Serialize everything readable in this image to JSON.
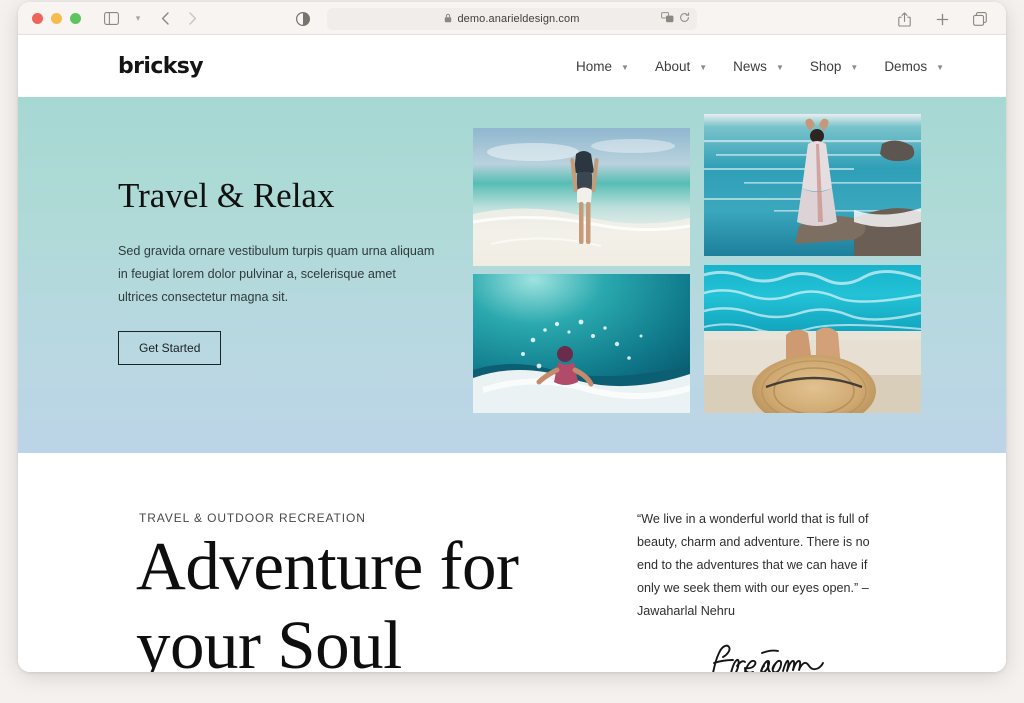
{
  "browser": {
    "url": "demo.anarieldesign.com",
    "lock_icon": "lock-icon",
    "reader_icon": "reader-appearance-icon",
    "sidebar_icon": "sidebar-toggle-icon",
    "back_icon": "back-arrow-icon",
    "forward_icon": "forward-arrow-icon",
    "extension_icon": "extension-icon",
    "reload_icon": "reload-icon",
    "share_icon": "share-icon",
    "newtab_icon": "plus-icon",
    "tabs_icon": "tab-overview-icon",
    "traffic_lights": [
      "close",
      "minimize",
      "maximize"
    ]
  },
  "site": {
    "logo": "bricksy",
    "nav": [
      {
        "label": "Home",
        "caret": "chevron-down-icon"
      },
      {
        "label": "About",
        "caret": "chevron-down-icon"
      },
      {
        "label": "News",
        "caret": "chevron-down-icon"
      },
      {
        "label": "Shop",
        "caret": "chevron-down-icon"
      },
      {
        "label": "Demos",
        "caret": "chevron-down-icon"
      }
    ]
  },
  "hero": {
    "title": "Travel & Relax",
    "paragraph": "Sed gravida ornare vestibulum turpis quam urna aliquam in feugiat lorem dolor pulvinar a, scelerisque amet ultrices consectetur magna sit.",
    "button": "Get Started",
    "gradient_top": "#a6d8d3",
    "gradient_bottom": "#bcd4e7",
    "photos": [
      {
        "name": "photo-woman-walking-on-beach"
      },
      {
        "name": "photo-woman-on-rock-by-sea"
      },
      {
        "name": "photo-child-playing-in-waves"
      },
      {
        "name": "photo-sun-hat-by-pool"
      }
    ]
  },
  "section2": {
    "eyebrow": "TRAVEL & OUTDOOR RECREATION",
    "title": "Adventure for your Soul",
    "quote": "“We live in a wonderful world that is full of beauty, charm and adventure. There is no end to the adventures that we can have if only we seek them with our eyes open.” – Jawaharlal Nehru",
    "signature": "freedom"
  }
}
